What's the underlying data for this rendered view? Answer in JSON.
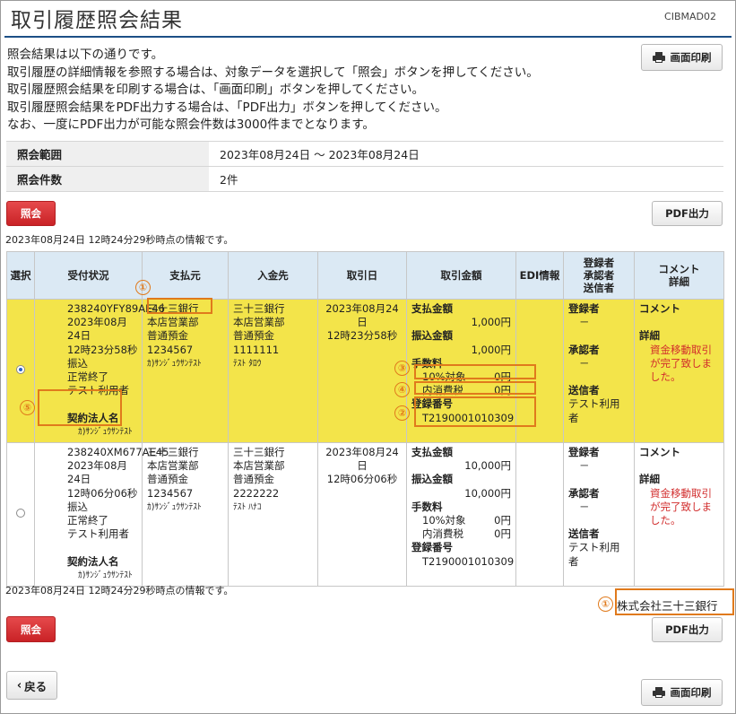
{
  "page": {
    "title": "取引履歴照会結果",
    "screen_id": "CIBMAD02",
    "intro_lines": [
      "照会結果は以下の通りです。",
      "取引履歴の詳細情報を参照する場合は、対象データを選択して「照会」ボタンを押してください。",
      "取引履歴照会結果を印刷する場合は、「画面印刷」ボタンを押してください。",
      "取引履歴照会結果をPDF出力する場合は、「PDF出力」ボタンを押してください。",
      "なお、一度にPDF出力が可能な照会件数は3000件までとなります。"
    ]
  },
  "buttons": {
    "print_label": "画面印刷",
    "inquiry_label": "照会",
    "pdf_label": "PDF出力",
    "back_label": "戻る"
  },
  "summary": {
    "range_label": "照会範囲",
    "range_value": "2023年08月24日 ～ 2023年08月24日",
    "count_label": "照会件数",
    "count_value": "2件"
  },
  "timestamp": "2023年08月24日 12時24分29秒時点の情報です。",
  "table": {
    "headers": {
      "select": "選択",
      "status": "受付状況",
      "from": "支払元",
      "to": "入金先",
      "date": "取引日",
      "amount": "取引金額",
      "edi": "EDI情報",
      "reg1": "登録者",
      "reg2": "承認者",
      "reg3": "送信者",
      "comment1": "コメント",
      "comment2": "詳細"
    },
    "labels": {
      "corp_name": "契約法人名",
      "pay_amount": "支払金額",
      "transfer_amount": "振込金額",
      "fee": "手数料",
      "tax10": "10%対象",
      "tax_incl": "内消費税",
      "reg_no": "登録番号",
      "registrant": "登録者",
      "approver": "承認者",
      "sender": "送信者",
      "comment": "コメント",
      "detail": "詳細"
    },
    "rows": [
      {
        "id": "238240YFY89AE46",
        "date_line": "2023年08月24日",
        "time_line": "12時23分58秒",
        "type": "振込",
        "result": "正常終了",
        "user": "テスト利用者",
        "corp_name": "ｶ)ｻﾝｼﾞｭｳｻﾝﾃｽﾄ",
        "from_bank": "三十三銀行",
        "from_branch": "本店営業部",
        "from_type": "普通預金",
        "from_acct": "1234567",
        "from_name": "ｶ)ｻﾝｼﾞｭｳｻﾝﾃｽﾄ",
        "to_bank": "三十三銀行",
        "to_branch": "本店営業部",
        "to_type": "普通預金",
        "to_acct": "1111111",
        "to_name": "ﾃｽﾄ ﾀﾛｳ",
        "trade_date": "2023年08月24日",
        "trade_time": "12時23分58秒",
        "pay_amount": "1,000円",
        "transfer_amount": "1,000円",
        "tax10": "0円",
        "tax_incl": "0円",
        "reg_no": "T2190001010309",
        "registrant": "－",
        "approver": "－",
        "sender": "テスト利用者",
        "detail_text": "資金移動取引が完了致しました。"
      },
      {
        "id": "238240XM677AE45",
        "date_line": "2023年08月24日",
        "time_line": "12時06分06秒",
        "type": "振込",
        "result": "正常終了",
        "user": "テスト利用者",
        "corp_name": "ｶ)ｻﾝｼﾞｭｳｻﾝﾃｽﾄ",
        "from_bank": "三十三銀行",
        "from_branch": "本店営業部",
        "from_type": "普通預金",
        "from_acct": "1234567",
        "from_name": "ｶ)ｻﾝｼﾞｭｳｻﾝﾃｽﾄ",
        "to_bank": "三十三銀行",
        "to_branch": "本店営業部",
        "to_type": "普通預金",
        "to_acct": "2222222",
        "to_name": "ﾃｽﾄ ﾊﾅｺ",
        "trade_date": "2023年08月24日",
        "trade_time": "12時06分06秒",
        "pay_amount": "10,000円",
        "transfer_amount": "10,000円",
        "tax10": "0円",
        "tax_incl": "0円",
        "reg_no": "T2190001010309",
        "registrant": "－",
        "approver": "－",
        "sender": "テスト利用者",
        "detail_text": "資金移動取引が完了致しました。"
      }
    ]
  },
  "annotations": {
    "n1": "①",
    "n2": "②",
    "n3": "③",
    "n4": "④",
    "n5": "⑤",
    "bank_name": "株式会社三十三銀行",
    "accent_color": "#e07a1c"
  },
  "colors": {
    "selected_row": "#f3e44a",
    "header_bg": "#dbe9f4",
    "title_rule": "#1c4f86",
    "primary_button": "#d8292c",
    "detail_text": "#d12b2b"
  }
}
